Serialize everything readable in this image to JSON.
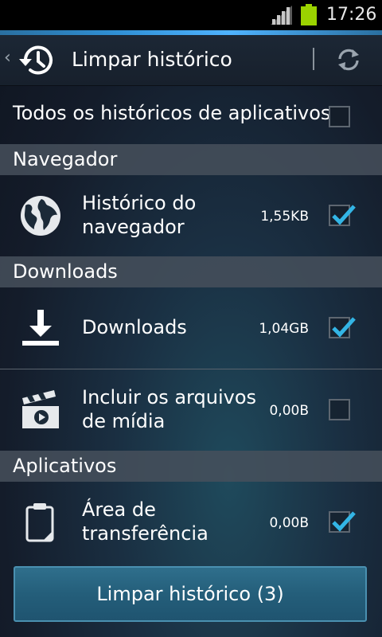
{
  "status_bar": {
    "time": "17:26",
    "icons": [
      "signal-icon",
      "battery-icon"
    ]
  },
  "action_bar": {
    "title": "Limpar histórico",
    "back_glyph": "‹",
    "icons": [
      "history-icon",
      "refresh-icon"
    ]
  },
  "all_apps": {
    "label": "Todos os históricos de aplicativos",
    "checked": false
  },
  "sections": [
    {
      "title": "Navegador",
      "items": [
        {
          "label_line1": "Histórico do",
          "label_line2": "navegador",
          "size": "1,55KB",
          "checked": true,
          "icon": "globe-icon"
        }
      ]
    },
    {
      "title": "Downloads",
      "items": [
        {
          "label_line1": "Downloads",
          "label_line2": "",
          "size": "1,04GB",
          "checked": true,
          "icon": "download-icon"
        },
        {
          "label_line1": "Incluir os arquivos",
          "label_line2": "de mídia",
          "size": "0,00B",
          "checked": false,
          "icon": "media-clapper-icon"
        }
      ]
    },
    {
      "title": "Aplicativos",
      "items": [
        {
          "label_line1": "Área de",
          "label_line2": "transferência",
          "size": "0,00B",
          "checked": true,
          "icon": "clipboard-icon"
        }
      ]
    }
  ],
  "clear_button": {
    "label": "Limpar histórico (3)"
  },
  "colors": {
    "accent": "#33b5e5",
    "section_bg": "#464f5a",
    "button": "#2a6684"
  }
}
